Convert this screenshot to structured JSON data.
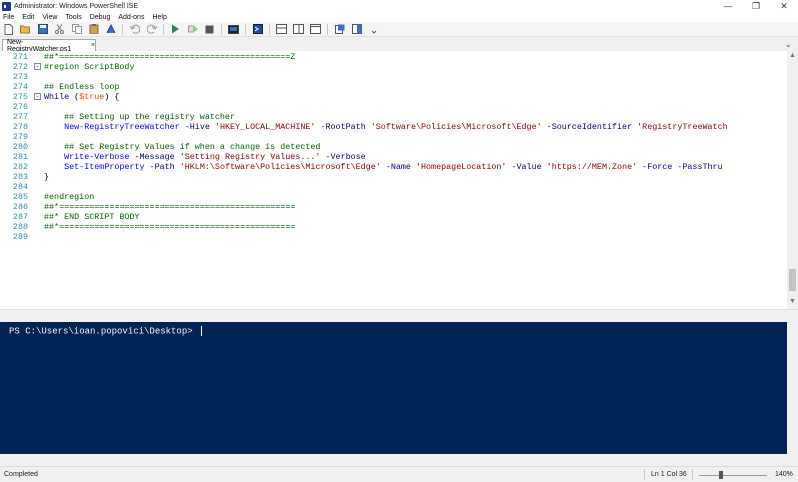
{
  "window": {
    "title": "Administrator: Windows PowerShell ISE",
    "minimize_glyph": "—",
    "maximize_glyph": "❐",
    "close_glyph": "✕"
  },
  "menu": [
    "File",
    "Edit",
    "View",
    "Tools",
    "Debug",
    "Add-ons",
    "Help"
  ],
  "toolbar": {
    "icons": [
      "new-file-icon",
      "open-file-icon",
      "save-icon",
      "cut-icon",
      "copy-icon",
      "paste-icon",
      "clear-icon",
      "undo-icon",
      "redo-icon",
      "run-script-icon",
      "run-selection-icon",
      "stop-icon",
      "new-remote-tab-icon",
      "start-powershell-icon",
      "show-script-top-icon",
      "show-script-right-icon",
      "show-script-max-icon",
      "show-command-icon",
      "show-command-addon-icon",
      "toolbar-overflow-icon"
    ],
    "colors": {
      "run": "#2e8b57",
      "stop": "#555555"
    }
  },
  "tab": {
    "label": "New-RegistryWatcher.ps1",
    "close_glyph": "×",
    "overflow_glyph": "⌄"
  },
  "editor": {
    "lines": [
      {
        "n": "271",
        "fold": "",
        "segs": [
          [
            "c-comment",
            "##*==============================================Z"
          ]
        ]
      },
      {
        "n": "272",
        "fold": "-",
        "segs": [
          [
            "c-comment",
            "#region ScriptBody"
          ]
        ]
      },
      {
        "n": "273",
        "fold": "",
        "segs": []
      },
      {
        "n": "274",
        "fold": "",
        "segs": [
          [
            "c-comment",
            "## Endless loop"
          ]
        ]
      },
      {
        "n": "275",
        "fold": "-",
        "segs": [
          [
            "c-keyword",
            "While"
          ],
          [
            "",
            " ("
          ],
          [
            "c-var",
            "$true"
          ],
          [
            "",
            ") {"
          ]
        ]
      },
      {
        "n": "276",
        "fold": "",
        "segs": []
      },
      {
        "n": "277",
        "fold": "",
        "segs": [
          [
            "",
            "    "
          ],
          [
            "c-comment",
            "## Setting up the registry watcher"
          ]
        ]
      },
      {
        "n": "278",
        "fold": "",
        "segs": [
          [
            "",
            "    "
          ],
          [
            "c-cmd",
            "New-RegistryTreeWatcher"
          ],
          [
            "",
            " "
          ],
          [
            "c-param",
            "-Hive"
          ],
          [
            "",
            " "
          ],
          [
            "c-string",
            "'HKEY_LOCAL_MACHINE'"
          ],
          [
            "",
            " "
          ],
          [
            "c-param",
            "-RootPath"
          ],
          [
            "",
            " "
          ],
          [
            "c-string",
            "'Software\\Policies\\Microsoft\\Edge'"
          ],
          [
            "",
            " "
          ],
          [
            "c-param",
            "-SourceIdentifier"
          ],
          [
            "",
            " "
          ],
          [
            "c-string",
            "'RegistryTreeWatch"
          ]
        ]
      },
      {
        "n": "279",
        "fold": "",
        "segs": []
      },
      {
        "n": "280",
        "fold": "",
        "segs": [
          [
            "",
            "    "
          ],
          [
            "c-comment",
            "## Set Registry Values if when a change is detected"
          ]
        ]
      },
      {
        "n": "281",
        "fold": "",
        "segs": [
          [
            "",
            "    "
          ],
          [
            "c-cmd",
            "Write-Verbose"
          ],
          [
            "",
            " "
          ],
          [
            "c-param",
            "-Message"
          ],
          [
            "",
            " "
          ],
          [
            "c-string",
            "'Setting Registry Values...'"
          ],
          [
            "",
            " "
          ],
          [
            "c-param",
            "-Verbose"
          ]
        ]
      },
      {
        "n": "282",
        "fold": "",
        "segs": [
          [
            "",
            "    "
          ],
          [
            "c-cmd",
            "Set-ItemProperty"
          ],
          [
            "",
            " "
          ],
          [
            "c-param",
            "-Path"
          ],
          [
            "",
            " "
          ],
          [
            "c-string",
            "'HKLM:\\Software\\Policies\\Microsoft\\Edge'"
          ],
          [
            "",
            " "
          ],
          [
            "c-param",
            "-Name"
          ],
          [
            "",
            " "
          ],
          [
            "c-string",
            "'HomepageLocation'"
          ],
          [
            "",
            " "
          ],
          [
            "c-param",
            "-Value"
          ],
          [
            "",
            " "
          ],
          [
            "c-string",
            "'https://MEM.Zone'"
          ],
          [
            "",
            " "
          ],
          [
            "c-param",
            "-Force"
          ],
          [
            "",
            " "
          ],
          [
            "c-param",
            "-PassThru"
          ]
        ]
      },
      {
        "n": "283",
        "fold": "",
        "segs": [
          [
            "",
            "}"
          ]
        ]
      },
      {
        "n": "284",
        "fold": "",
        "segs": []
      },
      {
        "n": "285",
        "fold": "",
        "segs": [
          [
            "c-comment",
            "#endregion"
          ]
        ]
      },
      {
        "n": "286",
        "fold": "",
        "segs": [
          [
            "c-comment",
            "##*==============================================="
          ]
        ]
      },
      {
        "n": "287",
        "fold": "",
        "segs": [
          [
            "c-comment",
            "##* END SCRIPT BODY"
          ]
        ]
      },
      {
        "n": "288",
        "fold": "",
        "segs": [
          [
            "c-comment",
            "##*==============================================="
          ]
        ]
      },
      {
        "n": "289",
        "fold": "",
        "segs": []
      }
    ]
  },
  "console": {
    "prompt": "PS C:\\Users\\ioan.popovici\\Desktop> "
  },
  "status": {
    "text": "Completed",
    "position": "Ln 1  Col 36",
    "zoom": "140%"
  }
}
